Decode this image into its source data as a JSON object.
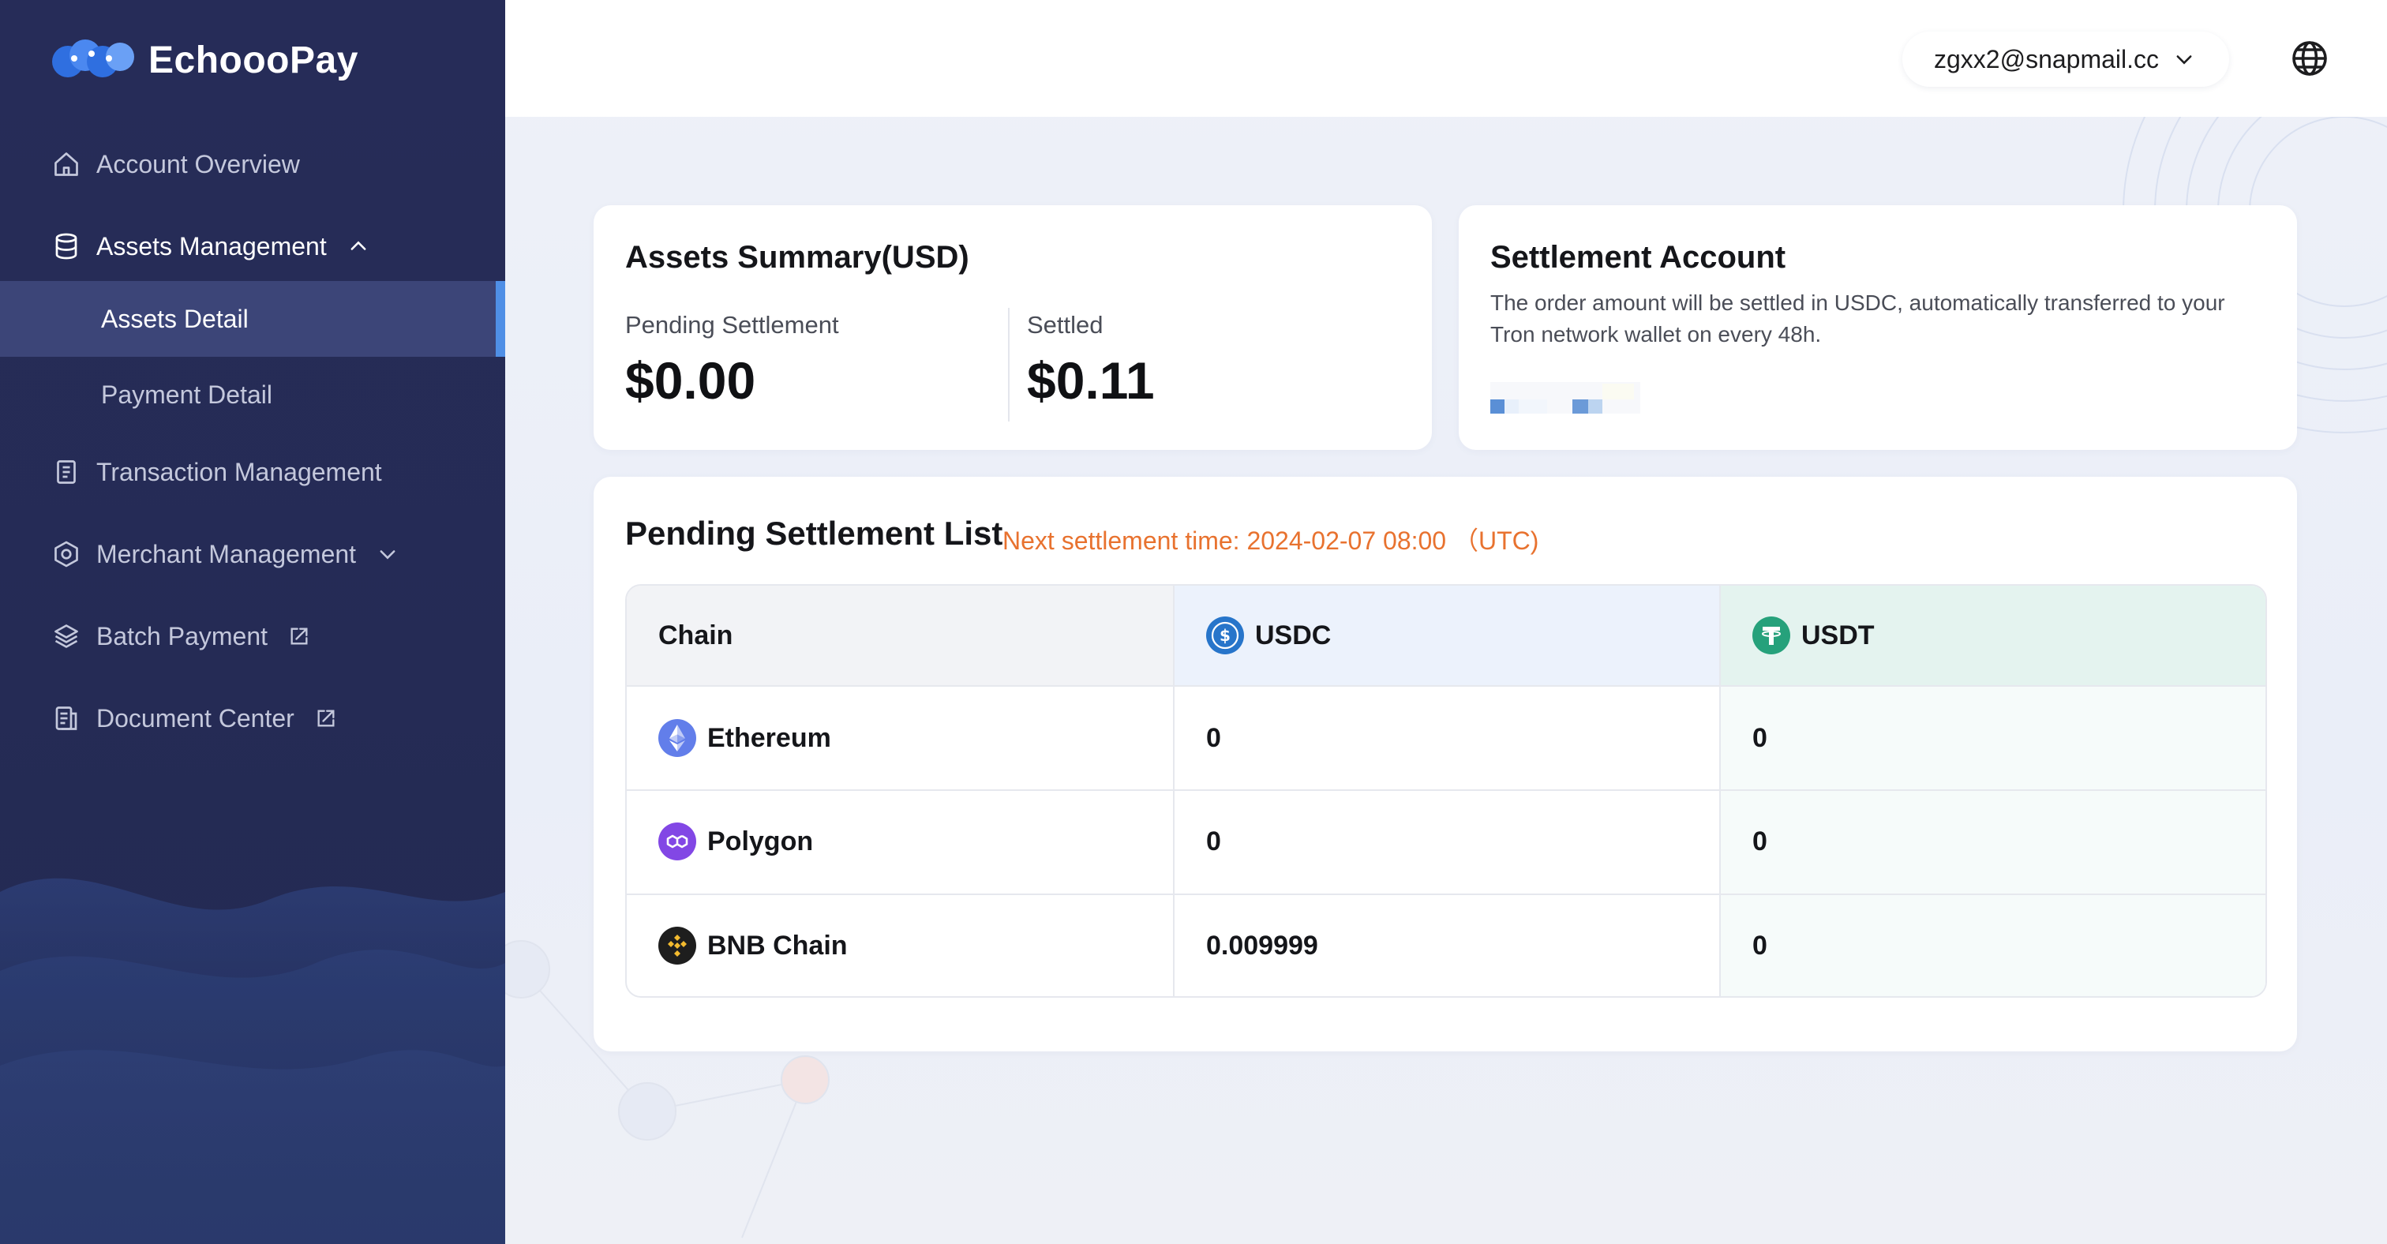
{
  "app": {
    "name": "EchoooPay"
  },
  "sidebar": {
    "items": [
      {
        "label": "Account Overview",
        "icon": "home-icon"
      },
      {
        "label": "Assets Management",
        "icon": "database-icon",
        "expanded": true,
        "children": [
          {
            "label": "Assets Detail",
            "active": true
          },
          {
            "label": "Payment Detail"
          }
        ]
      },
      {
        "label": "Transaction Management",
        "icon": "document-icon"
      },
      {
        "label": "Merchant Management",
        "icon": "hexagon-icon",
        "expanded": false
      },
      {
        "label": "Batch Payment",
        "icon": "layers-icon",
        "external": true
      },
      {
        "label": "Document Center",
        "icon": "file-icon",
        "external": true
      }
    ]
  },
  "header": {
    "user_email": "zgxx2@snapmail.cc",
    "language_icon": "globe-icon"
  },
  "assets_summary": {
    "title": "Assets Summary(USD)",
    "pending_label": "Pending Settlement",
    "pending_value": "$0.00",
    "settled_label": "Settled",
    "settled_value": "$0.11"
  },
  "settlement_account": {
    "title": "Settlement Account",
    "description": "The order amount will be settled in USDC, automatically transferred to your Tron network wallet on every 48h."
  },
  "pending_list": {
    "title": "Pending Settlement List",
    "next_time": "Next settlement time: 2024-02-07 08:00 （UTC)",
    "columns": [
      {
        "label": "Chain"
      },
      {
        "label": "USDC",
        "icon": "usdc-icon"
      },
      {
        "label": "USDT",
        "icon": "usdt-icon"
      }
    ],
    "rows": [
      {
        "chain": "Ethereum",
        "icon": "ethereum-icon",
        "usdc": "0",
        "usdt": "0"
      },
      {
        "chain": "Polygon",
        "icon": "polygon-icon",
        "usdc": "0",
        "usdt": "0"
      },
      {
        "chain": "BNB Chain",
        "icon": "bnb-icon",
        "usdc": "0.009999",
        "usdt": "0"
      }
    ]
  },
  "colors": {
    "sidebar_bg": "#262c58",
    "active_item_bg": "#3c4578",
    "active_indicator": "#4f8fe6",
    "accent_orange": "#e8722f",
    "usdc_blue": "#2775ca",
    "usdt_green": "#26a17b"
  }
}
